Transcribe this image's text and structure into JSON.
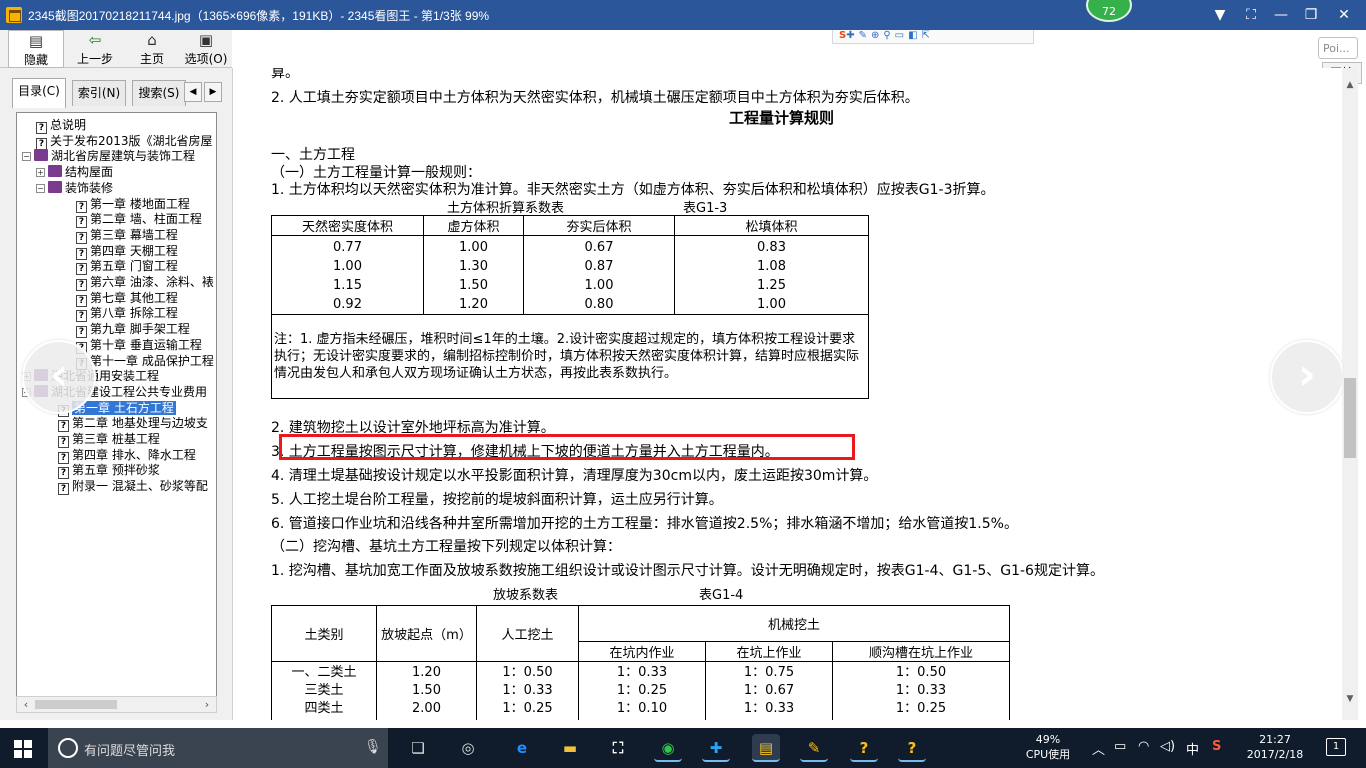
{
  "window": {
    "title": "2345截图20170218211744.jpg（1365×696像素，191KB）- 2345看图王 - 第1/3张 99%",
    "badge": "72"
  },
  "toolbar": {
    "buttons": [
      {
        "label": "隐藏",
        "icon": "hide-icon"
      },
      {
        "label": "上一步",
        "icon": "back-arrow-icon"
      },
      {
        "label": "主页",
        "icon": "home-icon"
      },
      {
        "label": "选项(O)",
        "icon": "options-icon"
      }
    ]
  },
  "overlay": {
    "poi_text": "Poi...",
    "start_label": "开始"
  },
  "sidebar": {
    "tabs": [
      "目录(C)",
      "索引(N)",
      "搜索(S)"
    ],
    "tree": [
      {
        "label": "总说明",
        "level": 1,
        "type": "topic"
      },
      {
        "label": "关于发布2013版《湖北省房屋",
        "level": 1,
        "type": "topic"
      },
      {
        "label": "湖北省房屋建筑与装饰工程",
        "level": 0,
        "type": "book",
        "toggle": "−"
      },
      {
        "label": "结构屋面",
        "level": 1,
        "type": "book",
        "toggle": "+"
      },
      {
        "label": "装饰装修",
        "level": 1,
        "type": "book",
        "toggle": "−"
      },
      {
        "label": "第一章 楼地面工程",
        "level": 3,
        "type": "topic"
      },
      {
        "label": "第二章 墙、柱面工程",
        "level": 3,
        "type": "topic"
      },
      {
        "label": "第三章 幕墙工程",
        "level": 3,
        "type": "topic"
      },
      {
        "label": "第四章 天棚工程",
        "level": 3,
        "type": "topic"
      },
      {
        "label": "第五章 门窗工程",
        "level": 3,
        "type": "topic"
      },
      {
        "label": "第六章 油漆、涂料、裱",
        "level": 3,
        "type": "topic"
      },
      {
        "label": "第七章 其他工程",
        "level": 3,
        "type": "topic"
      },
      {
        "label": "第八章 拆除工程",
        "level": 3,
        "type": "topic"
      },
      {
        "label": "第九章 脚手架工程",
        "level": 3,
        "type": "topic"
      },
      {
        "label": "第十章 垂直运输工程",
        "level": 3,
        "type": "topic"
      },
      {
        "label": "第十一章 成品保护工程",
        "level": 3,
        "type": "topic"
      },
      {
        "label": "湖北省通用安装工程",
        "level": 0,
        "type": "book",
        "toggle": "+"
      },
      {
        "label": "湖北省建设工程公共专业费用",
        "level": 0,
        "type": "book",
        "toggle": "−"
      },
      {
        "label": "第一章 土石方工程",
        "level": 2,
        "type": "topic",
        "selected": true
      },
      {
        "label": "第二章 地基处理与边坡支",
        "level": 2,
        "type": "topic"
      },
      {
        "label": "第三章 桩基工程",
        "level": 2,
        "type": "topic"
      },
      {
        "label": "第四章 排水、降水工程",
        "level": 2,
        "type": "topic"
      },
      {
        "label": "第五章 预拌砂浆",
        "level": 2,
        "type": "topic"
      },
      {
        "label": "附录一 混凝土、砂浆等配",
        "level": 2,
        "type": "topic"
      }
    ]
  },
  "document": {
    "line_top_cut": "算。",
    "line_intro2": "2. 人工填土夯实定额项目中土方体积为天然密实体积，机械填土碾压定额项目中土方体积为夯实后体积。",
    "heading": "工程量计算规则",
    "section1": "一、土方工程",
    "sub1": "（一）土方工程量计算一般规则：",
    "rule1": "1. 土方体积均以天然密实体积为准计算。非天然密实土方（如虚方体积、夯实后体积和松填体积）应按表G1-3折算。",
    "table1_caption": "土方体积折算系数表",
    "table1_code": "表G1-3",
    "table1": {
      "headers": [
        "天然密实度体积",
        "虚方体积",
        "夯实后体积",
        "松填体积"
      ],
      "rows": [
        [
          "0.77",
          "1.00",
          "0.67",
          "0.83"
        ],
        [
          "1.00",
          "1.30",
          "0.87",
          "1.08"
        ],
        [
          "1.15",
          "1.50",
          "1.00",
          "1.25"
        ],
        [
          "0.92",
          "1.20",
          "0.80",
          "1.00"
        ]
      ],
      "note": "注：1. 虚方指未经碾压，堆积时间≤1年的土壤。2.设计密实度超过规定的，填方体积按工程设计要求执行；无设计密实度要求的，编制招标控制价时，填方体积按天然密实度体积计算，结算时应根据实际情况由发包人和承包人双方现场证确认土方状态，再按此表系数执行。"
    },
    "rule2": "2. 建筑物挖土以设计室外地坪标高为准计算。",
    "rule3": "3. 土方工程量按图示尺寸计算，修建机械上下坡的便道土方量并入土方工程量内。",
    "rule4": "4. 清理土堤基础按设计规定以水平投影面积计算，清理厚度为30cm以内，废土运距按30m计算。",
    "rule5": "5. 人工挖土堤台阶工程量，按挖前的堤坡斜面积计算，运土应另行计算。",
    "rule6": "6. 管道接口作业坑和沿线各种井室所需增加开挖的土方工程量：排水管道按2.5%；排水箱涵不增加；给水管道按1.5%。",
    "sub2": "（二）挖沟槽、基坑土方工程量按下列规定以体积计算：",
    "rule2_1": "1. 挖沟槽、基坑加宽工作面及放坡系数按施工组织设计或设计图示尺寸计算。设计无明确规定时，按表G1-4、G1-5、G1-6规定计算。",
    "table2_caption": "放坡系数表",
    "table2_code": "表G1-4",
    "table2": {
      "headers": [
        "土类别",
        "放坡起点（m）",
        "人工挖土",
        "机械挖土"
      ],
      "subheaders": [
        "在坑内作业",
        "在坑上作业",
        "顺沟槽在坑上作业"
      ],
      "rows": [
        [
          "一、二类土",
          "1.20",
          "1：0.50",
          "1：0.33",
          "1：0.75",
          "1：0.50"
        ],
        [
          "三类土",
          "1.50",
          "1：0.33",
          "1：0.25",
          "1：0.67",
          "1：0.33"
        ],
        [
          "四类土",
          "2.00",
          "1：0.25",
          "1：0.10",
          "1：0.33",
          "1：0.25"
        ]
      ]
    }
  },
  "taskbar": {
    "search_placeholder": "有问题尽管问我",
    "cpu_percent": "49%",
    "cpu_label": "CPU使用",
    "ime": "中",
    "time": "21:27",
    "date": "2017/2/18"
  }
}
